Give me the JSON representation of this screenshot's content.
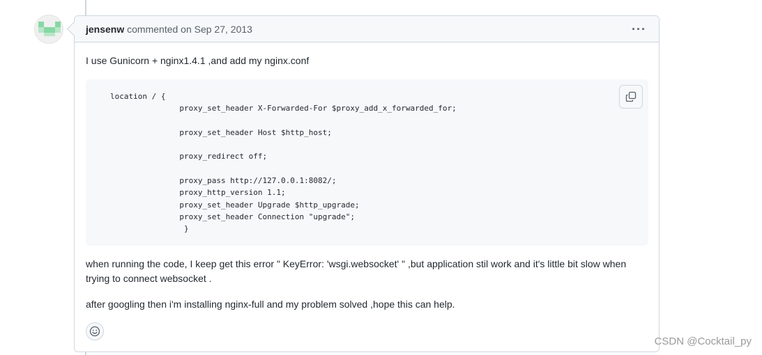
{
  "comment": {
    "author": "jensenw",
    "meta": " commented on Sep 27, 2013",
    "menu_icon": "kebab-horizontal-icon",
    "paragraph_1": "I use Gunicorn + nginx1.4.1 ,and add my nginx.conf",
    "code": "location / {\n               proxy_set_header X-Forwarded-For $proxy_add_x_forwarded_for;\n\n               proxy_set_header Host $http_host;\n\n               proxy_redirect off;\n\n               proxy_pass http://127.0.0.1:8082/;\n               proxy_http_version 1.1;\n               proxy_set_header Upgrade $http_upgrade;\n               proxy_set_header Connection \"upgrade\";\n                }",
    "copy_icon": "copy-icon",
    "paragraph_2": "when running the code, I keep get this error \" KeyError: 'wsgi.websocket' \" ,but application stil work and it's little bit slow when trying to connect websocket .",
    "paragraph_3": "after googling then i'm installing nginx-full and my problem solved ,hope this can help.",
    "reaction_icon": "smiley-icon"
  },
  "watermark": "CSDN @Cocktail_py",
  "colors": {
    "avatar_green": "#86d8a4",
    "border": "#d0d7de",
    "header_bg": "#f6f8fa"
  }
}
